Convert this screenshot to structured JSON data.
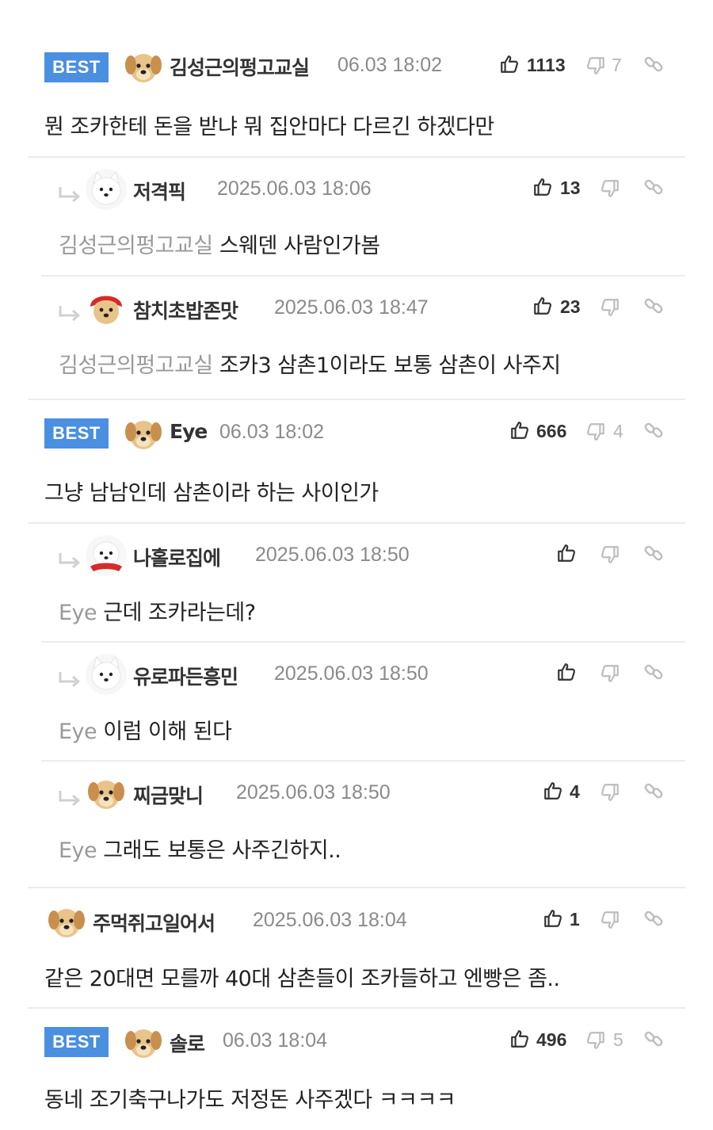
{
  "best_label": "BEST",
  "comments": [
    {
      "best": true,
      "nick": "김성근의펑고교실",
      "date": "06.03 18:02",
      "up": "1113",
      "down": "7",
      "text": "뭔 조카한테 돈을 받냐 뭐 집안마다 다르긴 하겠다만",
      "avatar": "puppy"
    },
    {
      "reply": true,
      "nick": "저격픽",
      "date": "2025.06.03 18:06",
      "up": "13",
      "down": "",
      "mention": "김성근의펑고교실",
      "text": "스웨덴 사람인가봄",
      "avatar": "white-dog"
    },
    {
      "reply": true,
      "nick": "참치초밥존맛",
      "date": "2025.06.03 18:47",
      "up": "23",
      "down": "",
      "mention": "김성근의펑고교실",
      "text": "조카3 삼촌1이라도 보통 삼촌이 사주지",
      "avatar": "puppy-red"
    },
    {
      "best": true,
      "nick": "Eye",
      "date": "06.03 18:02",
      "up": "666",
      "down": "4",
      "text": "그냥 남남인데 삼촌이라 하는 사이인가",
      "avatar": "puppy"
    },
    {
      "reply": true,
      "nick": "나홀로집에",
      "date": "2025.06.03 18:50",
      "up": "",
      "down": "",
      "mention": "Eye",
      "text": "근데 조카라는데?",
      "avatar": "white-dog-red"
    },
    {
      "reply": true,
      "nick": "유로파든흥민",
      "date": "2025.06.03 18:50",
      "up": "",
      "down": "",
      "mention": "Eye",
      "text": "이럼 이해 된다",
      "avatar": "white-dog"
    },
    {
      "reply": true,
      "nick": "찌금맞니",
      "date": "2025.06.03 18:50",
      "up": "4",
      "down": "",
      "mention": "Eye",
      "text": "그래도 보통은 사주긴하지..",
      "avatar": "puppy"
    },
    {
      "nick": "주먹쥐고일어서",
      "date": "2025.06.03 18:04",
      "up": "1",
      "down": "",
      "text": "같은 20대면 모를까 40대 삼촌들이 조카들하고 엔빵은 좀..",
      "avatar": "puppy"
    },
    {
      "best": true,
      "nick": "솔로",
      "date": "06.03 18:04",
      "up": "496",
      "down": "5",
      "text": "동네 조기축구나가도 저정돈 사주겠다 ㅋㅋㅋㅋ",
      "avatar": "puppy"
    }
  ],
  "colors": {
    "best_badge": "#4a8fe0",
    "date": "#8a8a8a",
    "mention": "#999999",
    "separator": "#ececec"
  },
  "icons": {
    "like": "thumb-up-icon",
    "dislike": "thumb-down-icon",
    "link": "link-icon",
    "reply": "reply-arrow-icon"
  }
}
